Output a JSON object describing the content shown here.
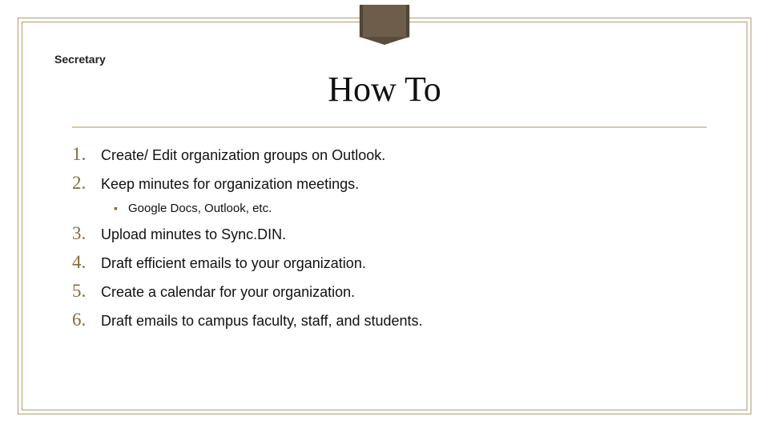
{
  "section_label": "Secretary",
  "title": "How To",
  "items": [
    {
      "n": "1.",
      "text": "Create/ Edit organization groups on Outlook."
    },
    {
      "n": "2.",
      "text": "Keep minutes for organization meetings."
    }
  ],
  "sub_bullet": "▪",
  "sub_text": "Google Docs, Outlook, etc.",
  "items2": [
    {
      "n": "3.",
      "text": "Upload minutes to Sync.DIN."
    },
    {
      "n": "4.",
      "text": "Draft efficient emails to your organization."
    },
    {
      "n": "5.",
      "text": "Create a calendar for your organization."
    },
    {
      "n": "6.",
      "text": "Draft emails to campus faculty, staff, and students."
    }
  ]
}
